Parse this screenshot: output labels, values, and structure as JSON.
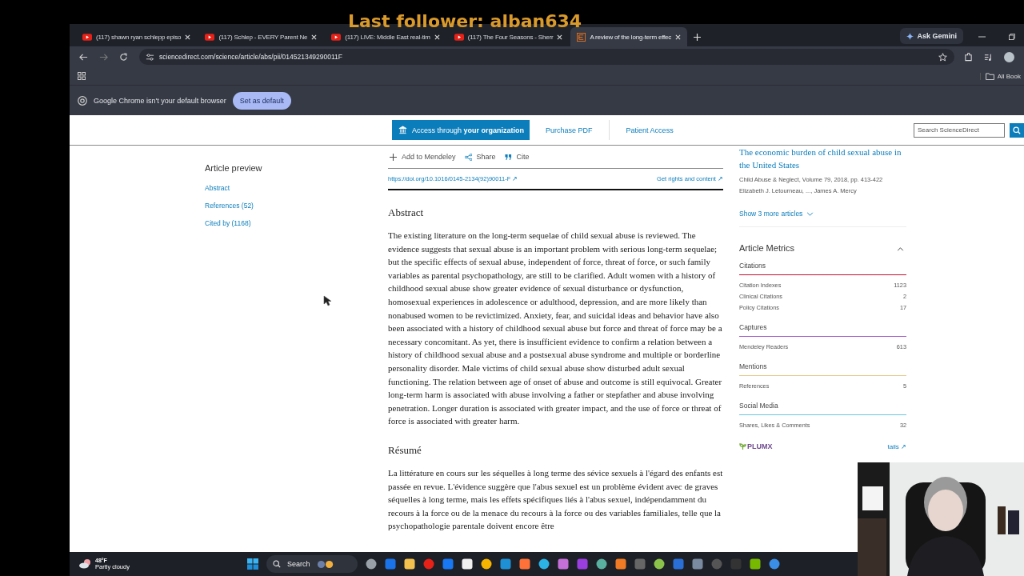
{
  "stream_overlay": {
    "text": "Last follower: alban634"
  },
  "browser": {
    "tabs": [
      {
        "title": "(117) shawn ryan schlepp episo",
        "kind": "youtube",
        "selected": false
      },
      {
        "title": "(117) Schlep - EVERY Parent Ne",
        "kind": "youtube",
        "selected": false
      },
      {
        "title": "(117) LIVE: Middle East real-tim",
        "kind": "youtube",
        "selected": false
      },
      {
        "title": "(117) The Four Seasons - Sherr",
        "kind": "youtube",
        "selected": false
      },
      {
        "title": "A review of the long-term effec",
        "kind": "journal",
        "selected": true
      }
    ],
    "ask_button": "Ask Gemini",
    "address": "sciencedirect.com/science/article/abs/pii/014521349290011F",
    "bookmarks": "All Book",
    "infobar": {
      "message": "Google Chrome isn't your default browser",
      "button": "Set as default"
    }
  },
  "page": {
    "header": {
      "access_button": "Access through **your organization**",
      "purchase": "Purchase PDF",
      "patient": "Patient Access",
      "search": {
        "placeholder": "Search ScienceDirect"
      }
    },
    "nav": {
      "title": "Article preview",
      "links": [
        "Abstract",
        "References (52)",
        "Cited by (1168)"
      ]
    },
    "actions": [
      "Add to Mendeley",
      "Share",
      "Cite"
    ],
    "doi": "https://doi.org/10.1016/0145-2134(92)90011-F ↗",
    "rights": "Get rights and content ↗",
    "sections": [
      {
        "heading": "Abstract",
        "text": "The existing literature on the long-term sequelae of child sexual abuse is reviewed. The evidence suggests that sexual abuse is an important problem with serious long-term sequelae; but the specific effects of sexual abuse, independent of force, threat of force, or such family variables as parental psychopathology, are still to be clarified. Adult women with a history of childhood sexual abuse show greater evidence of sexual disturbance or dysfunction, homosexual experiences in adolescence or adulthood, depression, and are more likely than nonabused women to be revictimized. Anxiety, fear, and suicidal ideas and behavior have also been associated with a history of childhood sexual abuse but force and threat of force may be a necessary concomitant. As yet, there is insufficient evidence to confirm a relation between a history of childhood sexual abuse and a postsexual abuse syndrome and multiple or borderline personality disorder. Male victims of child sexual abuse show disturbed adult sexual functioning. The relation between age of onset of abuse and outcome is still equivocal. Greater long-term harm is associated with abuse involving a father or stepfather and abuse involving penetration. Longer duration is associated with greater impact, and the use of force or threat of force is associated with greater harm."
      },
      {
        "heading": "Résumé",
        "text": "La littérature en cours sur les séquelles à long terme des sévice sexuels à l'égard des enfants est passée en revue. L'évidence suggère que l'abus sexuel est un problème évident avec de graves séquelles à long terme, mais les effets spécifiques liés à l'abus sexuel, indépendamment du recours à la force ou de la menace du recours à la force ou des variables familiales, telle que la psychopathologie parentale doivent encore être"
      }
    ],
    "related": {
      "title": "The economic burden of child sexual abuse in the United States",
      "journal": "Child Abuse & Neglect, Volume 79, 2018, pp. 413-422",
      "authors": "Elizabeth J. Letourneau, ..., James A. Mercy",
      "more": "Show 3 more articles"
    },
    "metrics": {
      "title": "Article Metrics",
      "expanded": true,
      "groups": [
        {
          "name": "Citations",
          "color": "#c8102e",
          "items": [
            {
              "label": "Citation Indexes",
              "value": "1123"
            },
            {
              "label": "Clinical Citations",
              "value": "2"
            },
            {
              "label": "Policy Citations",
              "value": "17"
            }
          ]
        },
        {
          "name": "Captures",
          "color": "#a45bc8",
          "items": [
            {
              "label": "Mendeley Readers",
              "value": "613"
            }
          ]
        },
        {
          "name": "Mentions",
          "color": "#e6c98a",
          "items": [
            {
              "label": "References",
              "value": "5"
            }
          ]
        },
        {
          "name": "Social Media",
          "color": "#6cc3dd",
          "items": [
            {
              "label": "Shares, Likes & Comments",
              "value": "32"
            }
          ]
        }
      ],
      "logo": "PLUMX",
      "details": "tails ↗"
    }
  },
  "taskbar": {
    "temperature": "48°F",
    "weather": "Partly cloudy",
    "search": "Search"
  }
}
